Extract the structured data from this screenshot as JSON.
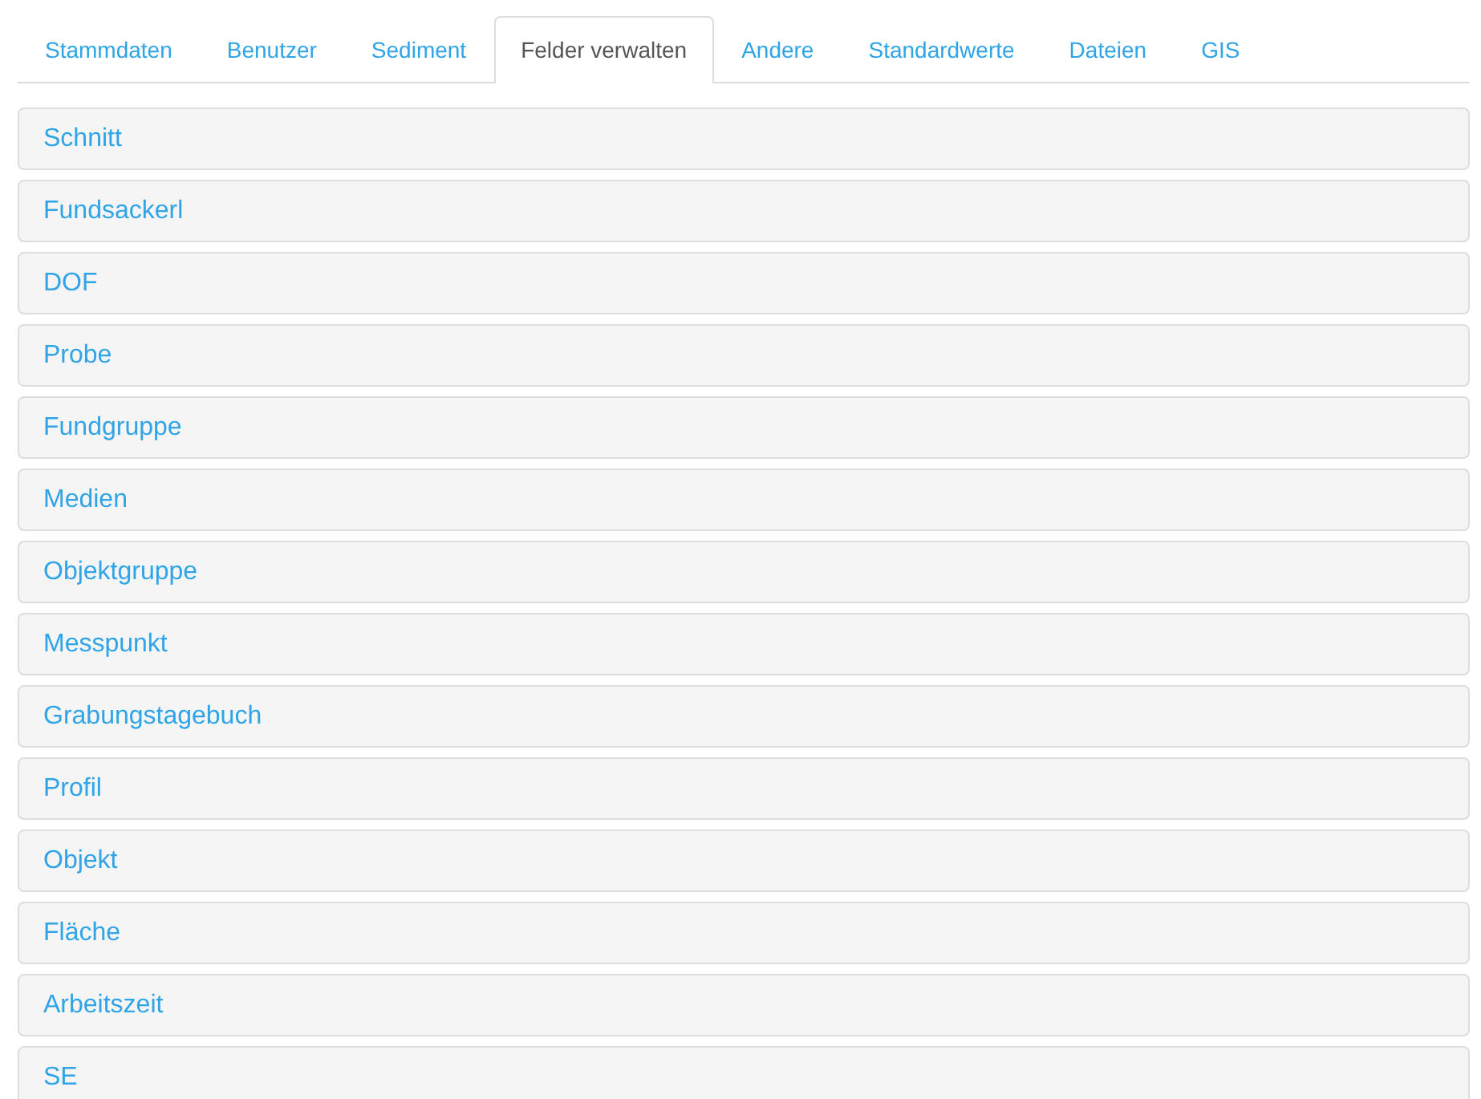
{
  "tabs": [
    {
      "label": "Stammdaten",
      "selected": false
    },
    {
      "label": "Benutzer",
      "selected": false
    },
    {
      "label": "Sediment",
      "selected": false
    },
    {
      "label": "Felder verwalten",
      "selected": true
    },
    {
      "label": "Andere",
      "selected": false
    },
    {
      "label": "Standardwerte",
      "selected": false
    },
    {
      "label": "Dateien",
      "selected": false
    },
    {
      "label": "GIS",
      "selected": false
    }
  ],
  "panels": [
    {
      "title": "Schnitt"
    },
    {
      "title": "Fundsackerl"
    },
    {
      "title": "DOF"
    },
    {
      "title": "Probe"
    },
    {
      "title": "Fundgruppe"
    },
    {
      "title": "Medien"
    },
    {
      "title": "Objektgruppe"
    },
    {
      "title": "Messpunkt"
    },
    {
      "title": "Grabungstagebuch"
    },
    {
      "title": "Profil"
    },
    {
      "title": "Objekt"
    },
    {
      "title": "Fläche"
    },
    {
      "title": "Arbeitszeit"
    },
    {
      "title": "SE"
    }
  ]
}
